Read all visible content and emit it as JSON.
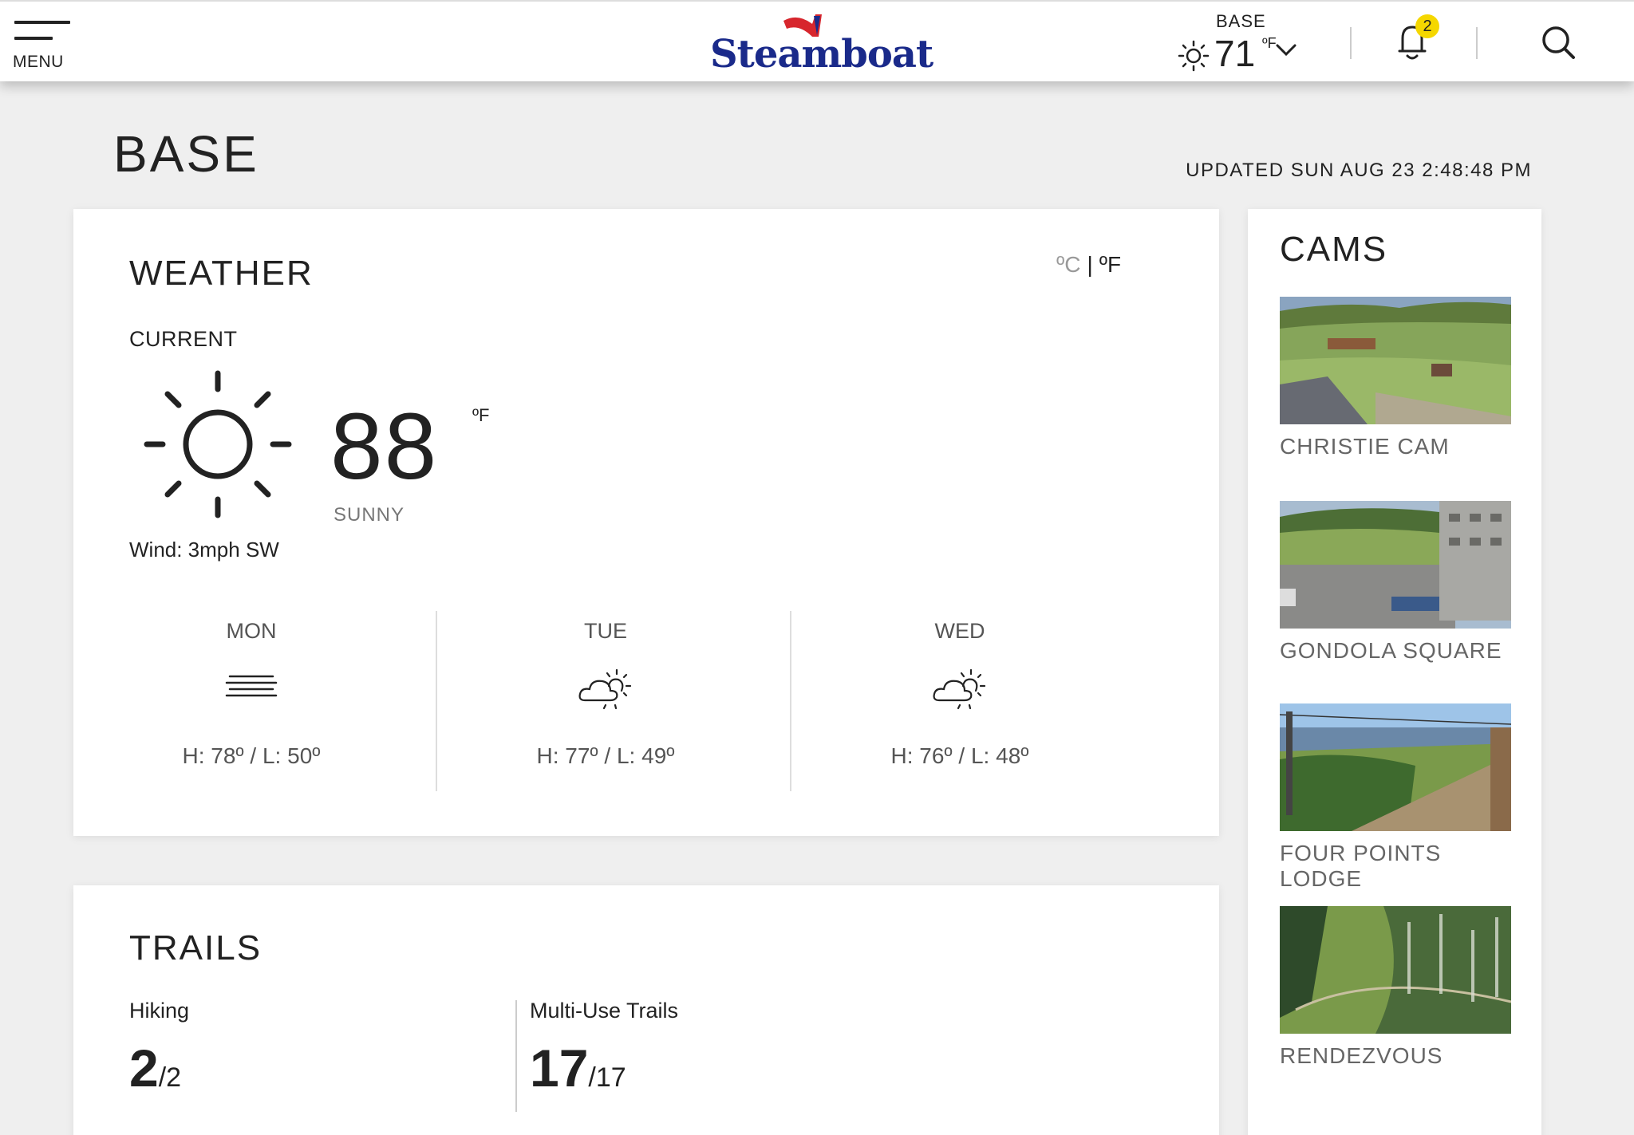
{
  "header": {
    "menu_label": "MENU",
    "logo_text": "Steamboat",
    "weather": {
      "location": "BASE",
      "temp": "71",
      "unit": "ºF"
    },
    "notifications_count": "2"
  },
  "page": {
    "title": "BASE",
    "updated": "UPDATED SUN AUG 23 2:48:48 PM"
  },
  "weather": {
    "title": "WEATHER",
    "unit_c": "ºC",
    "unit_sep": "|",
    "unit_f": "ºF",
    "current_label": "CURRENT",
    "current_temp": "88",
    "current_unit": "ºF",
    "condition": "SUNNY",
    "wind": "Wind: 3mph SW",
    "forecast": [
      {
        "day": "MON",
        "icon": "fog-icon",
        "hl": "H: 78º / L: 50º"
      },
      {
        "day": "TUE",
        "icon": "partly-cloudy-icon",
        "hl": "H: 77º / L: 49º"
      },
      {
        "day": "WED",
        "icon": "partly-cloudy-icon",
        "hl": "H: 76º / L: 48º"
      }
    ]
  },
  "trails": {
    "title": "TRAILS",
    "items": [
      {
        "name": "Hiking",
        "open": "2",
        "total": "/2"
      },
      {
        "name": "Multi-Use Trails",
        "open": "17",
        "total": "/17"
      }
    ]
  },
  "cams": {
    "title": "CAMS",
    "items": [
      {
        "label": "CHRISTIE CAM"
      },
      {
        "label": "GONDOLA SQUARE"
      },
      {
        "label": "FOUR POINTS LODGE"
      },
      {
        "label": "RENDEZVOUS"
      }
    ]
  },
  "colors": {
    "brand_blue": "#1a2a8a",
    "brand_red": "#d7262d",
    "badge_yellow": "#f5d700"
  }
}
